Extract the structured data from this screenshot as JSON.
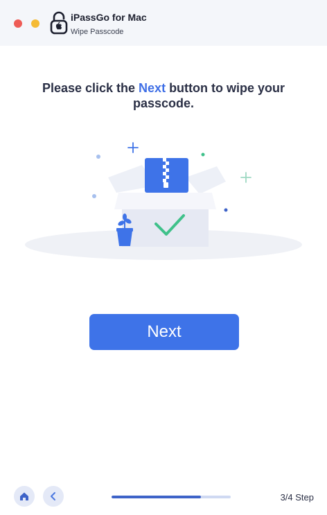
{
  "window": {
    "app_title": "iPassGo for Mac",
    "subtitle": "Wipe Passcode"
  },
  "main": {
    "instruction_before": "Please click the ",
    "instruction_highlight": "Next",
    "instruction_after": " button to wipe your passcode.",
    "next_label": "Next"
  },
  "footer": {
    "step_label": "3/4 Step",
    "progress": 0.75
  },
  "icons": {
    "close": "close-dot",
    "minimize": "minimize-dot",
    "logo": "lock-icon",
    "home": "home-icon",
    "back": "chevron-left-icon",
    "illustration": "open-box-with-zip-file-and-check-icon"
  },
  "colors": {
    "accent": "#3e73e8",
    "highlight": "#3f6fe6",
    "close": "#ee5c56",
    "minimize": "#f5bb35",
    "check": "#3fc18a"
  }
}
